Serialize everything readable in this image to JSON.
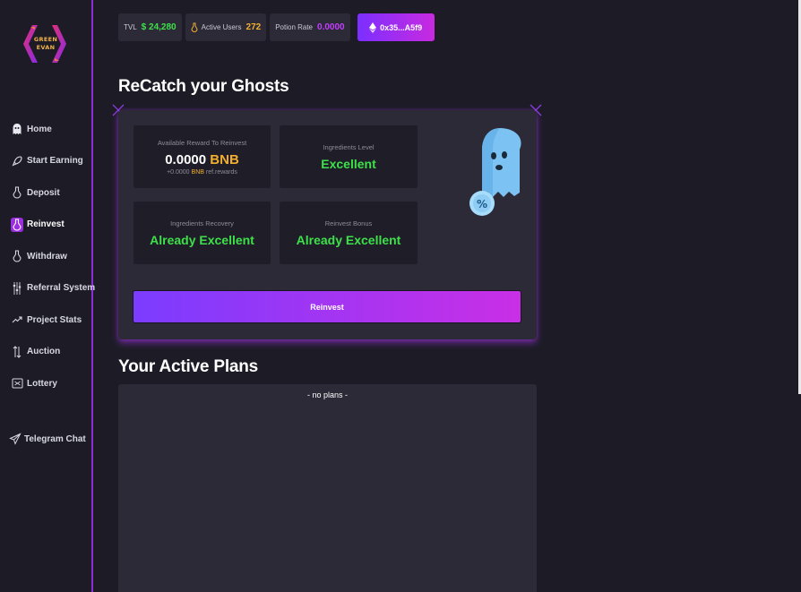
{
  "brand": {
    "logo_text_line1": "GREEN",
    "logo_text_line2": "EVAN"
  },
  "sidebar": {
    "items": [
      {
        "label": "Home",
        "icon": "ghost-icon"
      },
      {
        "label": "Start Earning",
        "icon": "rocket-icon"
      },
      {
        "label": "Deposit",
        "icon": "potion-icon"
      },
      {
        "label": "Reinvest",
        "icon": "potion-icon",
        "active": true
      },
      {
        "label": "Withdraw",
        "icon": "potion-icon"
      },
      {
        "label": "Referral System",
        "icon": "sliders-icon"
      },
      {
        "label": "Project Stats",
        "icon": "trend-icon"
      },
      {
        "label": "Auction",
        "icon": "arrows-icon"
      },
      {
        "label": "Lottery",
        "icon": "ticket-icon"
      }
    ],
    "telegram_label": "Telegram Chat"
  },
  "topbar": {
    "tvl_label": "TVL",
    "tvl_value": "$ 24,280",
    "users_label": "Active Users",
    "users_value": "272",
    "potion_label": "Potion Rate",
    "potion_value": "0.0000",
    "wallet": "0x35...A5f9"
  },
  "recatch": {
    "title": "ReCatch your Ghosts",
    "reward_label": "Available Reward To Reinvest",
    "reward_amount": "0.0000",
    "reward_unit": "BNB",
    "ref_amount": "+0.0000",
    "ref_unit": "BNB",
    "ref_suffix": "ref.rewards",
    "ingredients_level_label": "Ingredients Level",
    "ingredients_level_value": "Excellent",
    "ingredients_recovery_label": "Ingredients Recovery",
    "ingredients_recovery_value": "Already Excellent",
    "reinvest_bonus_label": "Reinvest Bonus",
    "reinvest_bonus_value": "Already Excellent",
    "button_label": "Reinvest"
  },
  "plans": {
    "title": "Your Active Plans",
    "empty_text": "- no plans -"
  },
  "colors": {
    "accent": "#9b2fe0",
    "green": "#3ee04a",
    "orange": "#f2ae2f",
    "background": "#1d1c26",
    "panel": "#2b2a36"
  }
}
